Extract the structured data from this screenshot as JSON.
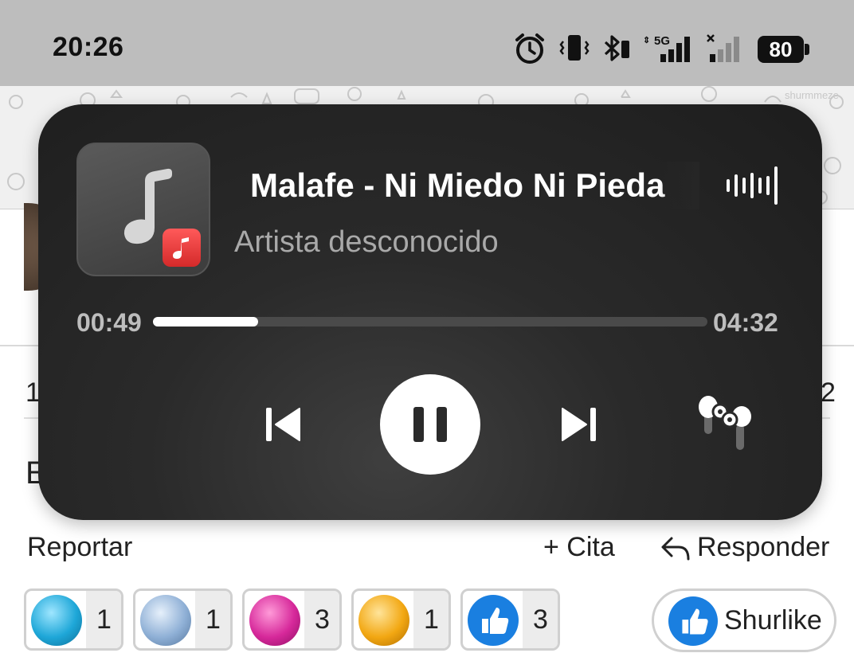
{
  "status_bar": {
    "time": "20:26",
    "icons": [
      "alarm-icon",
      "vibrate-icon",
      "bluetooth-icon",
      "signal-5g-icon",
      "signal-no-sim-icon"
    ],
    "network_label": "5G",
    "battery": "80"
  },
  "player": {
    "title": "Malafe - Ni Miedo Ni Pieda",
    "artist": "Artista desconocido",
    "elapsed": "00:49",
    "duration": "04:32",
    "progress": 0.19,
    "colors": {
      "background": "#262626",
      "accent": "#ffffff",
      "badge": "#e03a3a"
    }
  },
  "background": {
    "peek_left_1": "1",
    "peek_right_1": "2",
    "peek_left_2": "E"
  },
  "post_actions": {
    "report": "Reportar",
    "quote": "+ Cita",
    "reply": "Responder"
  },
  "reactions": [
    {
      "icon": "blue-diamond-icon",
      "count": "1",
      "color": "#1ea7d8"
    },
    {
      "icon": "silver-diamond-icon",
      "count": "1",
      "color": "#8fb0d6"
    },
    {
      "icon": "pink-diamond-icon",
      "count": "3",
      "color": "#d6289a"
    },
    {
      "icon": "gold-diamond-icon",
      "count": "1",
      "color": "#f2a712"
    },
    {
      "icon": "thumbs-up-icon",
      "count": "3",
      "color": "#1a7fe0"
    }
  ],
  "shurlike": {
    "label": "Shurlike"
  }
}
